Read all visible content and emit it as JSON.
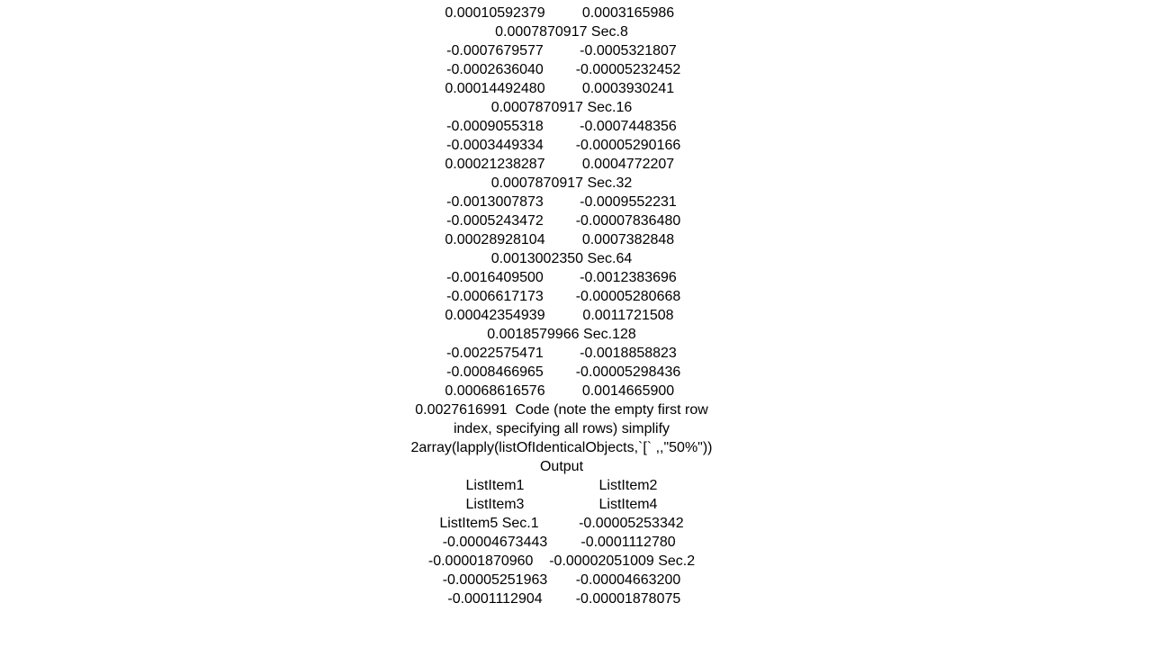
{
  "lines": [
    {
      "t": "pair",
      "a": "0.00010592379",
      "b": "0.0003165986"
    },
    {
      "t": "sec",
      "v": "0.0007870917",
      "label": "Sec.8"
    },
    {
      "t": "pair",
      "a": "-0.0007679577",
      "b": "-0.0005321807"
    },
    {
      "t": "pair",
      "a": "-0.0002636040",
      "b": "-0.00005232452"
    },
    {
      "t": "pair",
      "a": "0.00014492480",
      "b": "0.0003930241"
    },
    {
      "t": "sec",
      "v": "0.0007870917",
      "label": "Sec.16"
    },
    {
      "t": "pair",
      "a": "-0.0009055318",
      "b": "-0.0007448356"
    },
    {
      "t": "pair",
      "a": "-0.0003449334",
      "b": "-0.00005290166"
    },
    {
      "t": "pair",
      "a": "0.00021238287",
      "b": "0.0004772207"
    },
    {
      "t": "sec",
      "v": "0.0007870917",
      "label": "Sec.32"
    },
    {
      "t": "pair",
      "a": "-0.0013007873",
      "b": "-0.0009552231"
    },
    {
      "t": "pair",
      "a": "-0.0005243472",
      "b": "-0.00007836480"
    },
    {
      "t": "pair",
      "a": "0.00028928104",
      "b": "0.0007382848"
    },
    {
      "t": "sec",
      "v": "0.0013002350",
      "label": "Sec.64"
    },
    {
      "t": "pair",
      "a": "-0.0016409500",
      "b": "-0.0012383696"
    },
    {
      "t": "pair",
      "a": "-0.0006617173",
      "b": "-0.00005280668"
    },
    {
      "t": "pair",
      "a": "0.00042354939",
      "b": "0.0011721508"
    },
    {
      "t": "sec",
      "v": "0.0018579966",
      "label": "Sec.128"
    },
    {
      "t": "pair",
      "a": "-0.0022575471",
      "b": "-0.0018858823"
    },
    {
      "t": "pair",
      "a": "-0.0008466965",
      "b": "-0.00005298436"
    },
    {
      "t": "pair",
      "a": "0.00068616576",
      "b": "0.0014665900"
    },
    {
      "t": "text",
      "v": "0.0027616991  Code (note the empty first row index, specifying all rows) simplify 2array(lapply(listOfIdenticalObjects,`[` ,,\"50%\"))  Output"
    },
    {
      "t": "pair",
      "a": "ListItem1",
      "b": "ListItem2"
    },
    {
      "t": "pair",
      "a": "ListItem3",
      "b": "ListItem4"
    },
    {
      "t": "text",
      "v": "ListItem5 Sec.1          -0.00005253342"
    },
    {
      "t": "pair",
      "a": "-0.00004673443",
      "b": "-0.0001112780"
    },
    {
      "t": "text",
      "v": "-0.00001870960    -0.00002051009 Sec.2"
    },
    {
      "t": "pair",
      "a": "-0.00005251963",
      "b": "-0.00004663200"
    },
    {
      "t": "pair",
      "a": "-0.0001112904",
      "b": "-0.00001878075"
    }
  ]
}
